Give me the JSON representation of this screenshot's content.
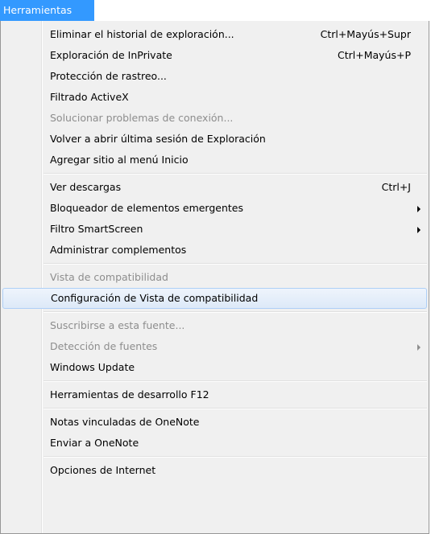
{
  "menubar": {
    "title": "Herramientas"
  },
  "menu": {
    "groups": [
      {
        "items": [
          {
            "label": "Eliminar el historial de exploración...",
            "shortcut": "Ctrl+Mayús+Supr"
          },
          {
            "label": "Exploración de InPrivate",
            "shortcut": "Ctrl+Mayús+P"
          },
          {
            "label": "Protección de rastreo..."
          },
          {
            "label": "Filtrado ActiveX"
          },
          {
            "label": "Solucionar problemas de conexión...",
            "disabled": true
          },
          {
            "label": "Volver a abrir última sesión de Exploración"
          },
          {
            "label": "Agregar sitio al menú Inicio"
          }
        ]
      },
      {
        "items": [
          {
            "label": "Ver descargas",
            "shortcut": "Ctrl+J"
          },
          {
            "label": "Bloqueador de elementos emergentes",
            "submenu": true
          },
          {
            "label": "Filtro SmartScreen",
            "submenu": true
          },
          {
            "label": "Administrar complementos"
          }
        ]
      },
      {
        "items": [
          {
            "label": "Vista de compatibilidad",
            "disabled": true
          },
          {
            "label": "Configuración de Vista de compatibilidad",
            "selected": true
          }
        ]
      },
      {
        "items": [
          {
            "label": "Suscribirse a esta fuente...",
            "disabled": true
          },
          {
            "label": "Detección de fuentes",
            "disabled": true,
            "submenu": true
          },
          {
            "label": "Windows Update"
          }
        ]
      },
      {
        "items": [
          {
            "label": "Herramientas de desarrollo F12"
          }
        ]
      },
      {
        "items": [
          {
            "label": "Notas vinculadas de OneNote"
          },
          {
            "label": "Enviar a OneNote"
          }
        ]
      },
      {
        "items": [
          {
            "label": "Opciones de Internet"
          }
        ]
      }
    ]
  }
}
